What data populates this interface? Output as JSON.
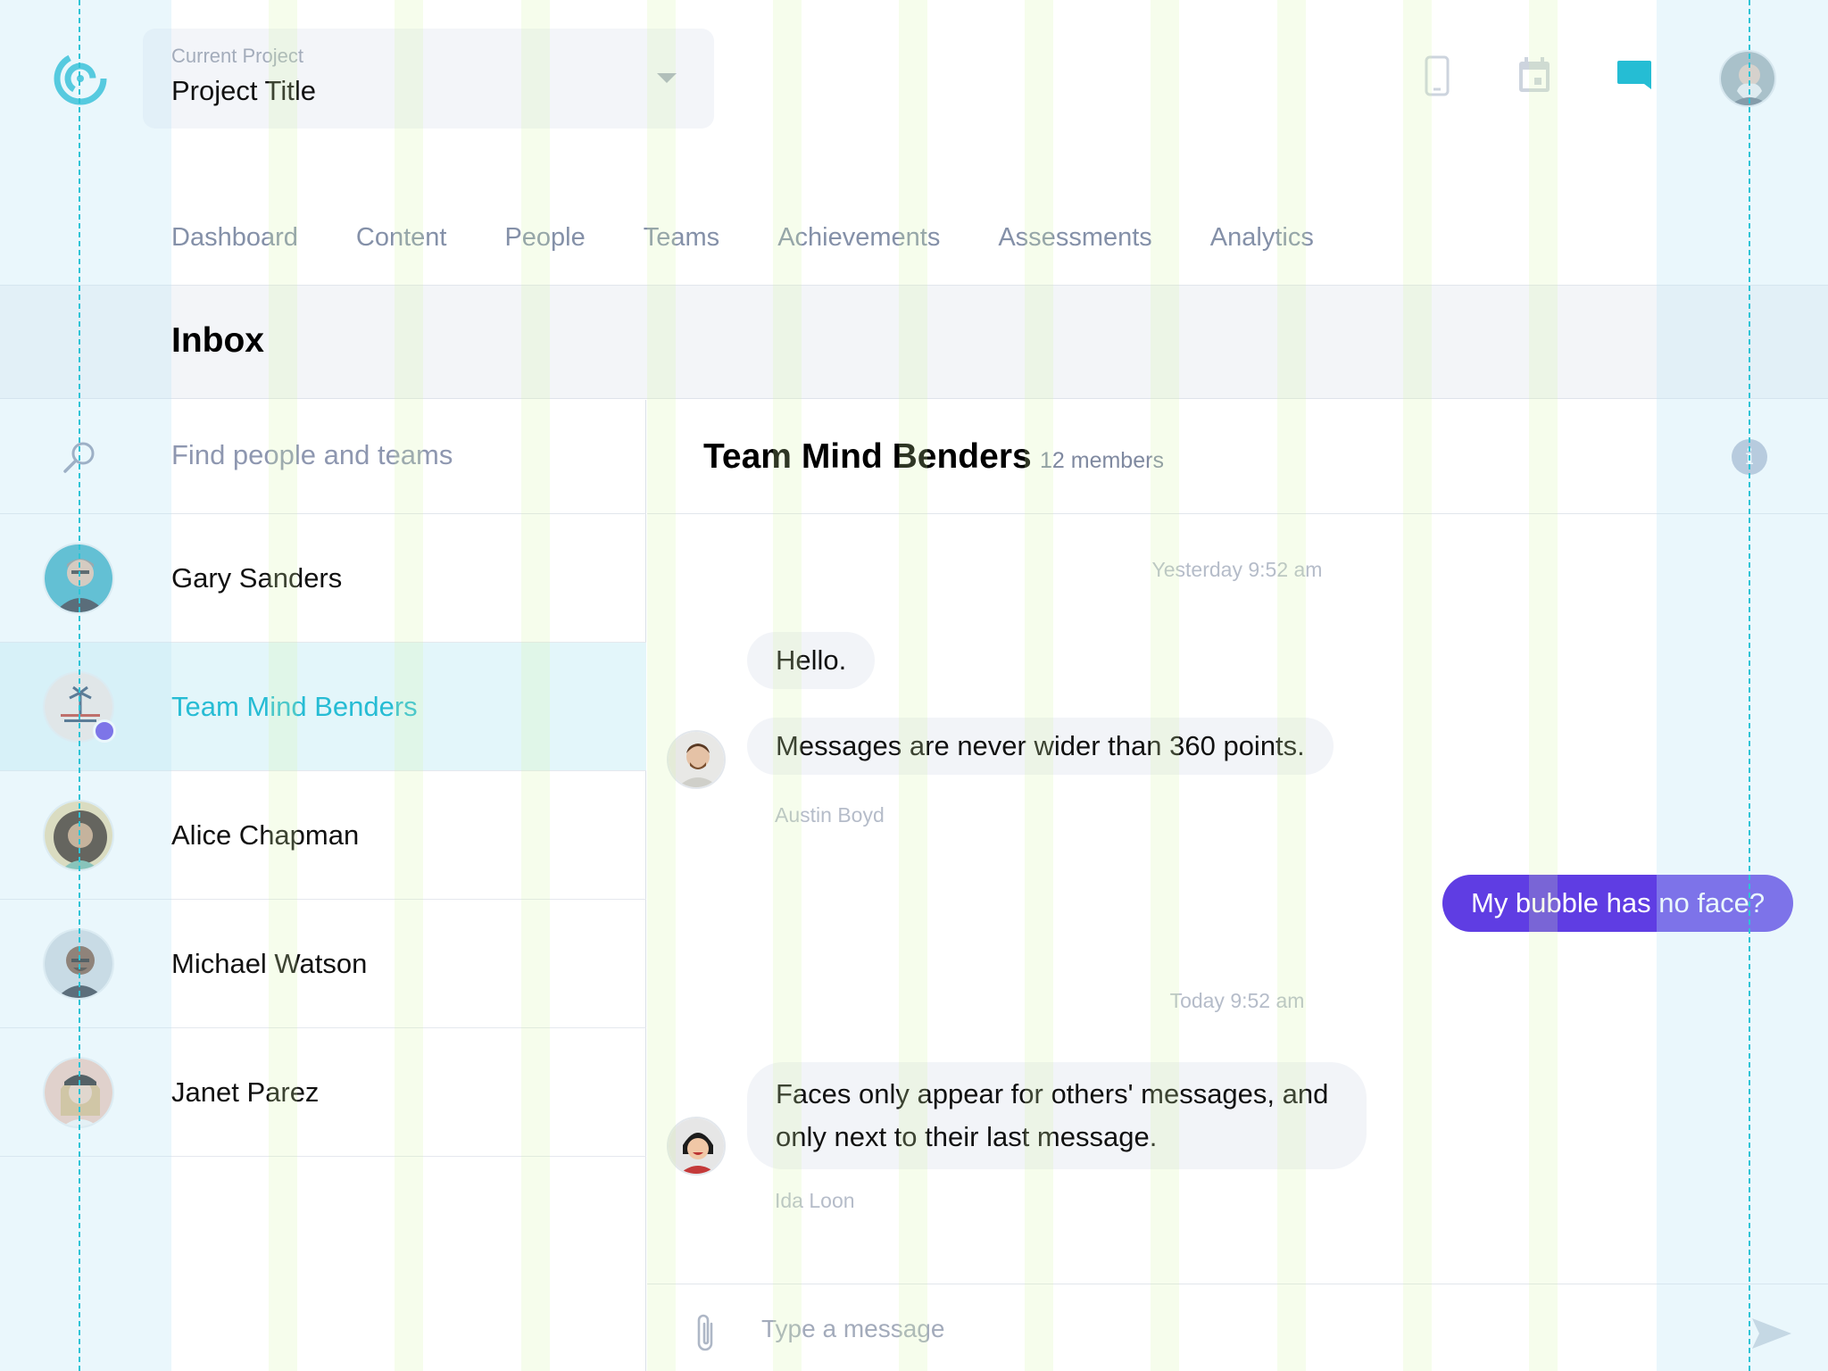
{
  "header": {
    "project_label": "Current Project",
    "project_title": "Project Title",
    "icons": [
      "logo-icon",
      "phone-icon",
      "calendar-icon",
      "chat-icon",
      "user-avatar"
    ]
  },
  "nav": {
    "items": [
      "Dashboard",
      "Content",
      "People",
      "Teams",
      "Achievements",
      "Assessments",
      "Analytics"
    ]
  },
  "inbox": {
    "title": "Inbox"
  },
  "search": {
    "placeholder": "Find people and teams"
  },
  "contacts": [
    {
      "name": "Gary Sanders",
      "active": false
    },
    {
      "name": "Team Mind Benders",
      "active": true,
      "unread": true
    },
    {
      "name": "Alice Chapman",
      "active": false
    },
    {
      "name": "Michael Watson",
      "active": false
    },
    {
      "name": "Janet Parez",
      "active": false
    }
  ],
  "chat": {
    "title": "Team Mind Benders",
    "members": "12 members",
    "info_icon": "i",
    "messages": {
      "ts_yesterday": "Yesterday 9:52 am",
      "hello": "Hello.",
      "wider": "Messages are never wider than 360 points.",
      "sender_austin": "Austin Boyd",
      "self": "My bubble has no face?",
      "ts_today": "Today 9:52 am",
      "faces": "Faces only appear for others' messages, and only next to their last message.",
      "sender_ida": "Ida Loon"
    },
    "composer_placeholder": "Type a message"
  },
  "colors": {
    "accent": "#26bcd4",
    "primary_bubble": "#5f3de3",
    "nav_text": "#8490a8",
    "guide_dash": "#2ec4d6"
  }
}
